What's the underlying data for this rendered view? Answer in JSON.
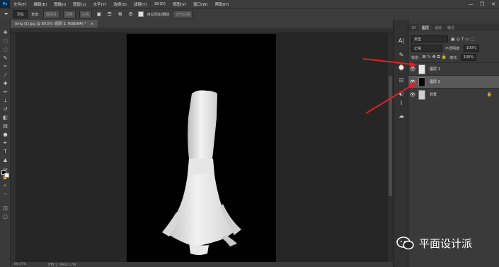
{
  "menubar": {
    "logo": "Ps",
    "items": [
      "文件(F)",
      "编辑(E)",
      "图像(I)",
      "图层(L)",
      "文字(Y)",
      "选择(S)",
      "滤镜(T)",
      "3D(D)",
      "视图(V)",
      "窗口(W)",
      "帮助(H)"
    ],
    "window_controls": [
      "—",
      "❐",
      "✕"
    ]
  },
  "options": {
    "mode": "羽化",
    "width_label": "宽度:",
    "btn1": "选择并",
    "btn2": "调整",
    "btn3": "边缘",
    "auto_add_label": "自动添加/删除",
    "align_edges": "对齐边缘"
  },
  "document": {
    "tab_title": "timg (1).jpg @ 89.5% (图层 2, RGB/8#) *",
    "close": "×"
  },
  "statusbar": {
    "zoom": "89.47%",
    "doc_info": "文档:1.79M/4.17M"
  },
  "panel": {
    "tabs": [
      "3D",
      "图层",
      "通道",
      "路径"
    ],
    "active_tab": "图层",
    "kind_label": "类型",
    "blend_mode": "正常",
    "opacity_label": "不透明度:",
    "opacity_value": "100%",
    "lock_label": "锁定:",
    "fill_label": "填充:",
    "fill_value": "100%",
    "layers": [
      {
        "name": "图层 1",
        "selected": false
      },
      {
        "name": "图层 2",
        "selected": true
      },
      {
        "name": "背景",
        "selected": false,
        "locked": true
      }
    ]
  },
  "watermark": {
    "text": "平面设计派"
  },
  "colors": {
    "accent": "#31a8ff",
    "arrow": "#e02020",
    "selected_layer": "#595959"
  }
}
